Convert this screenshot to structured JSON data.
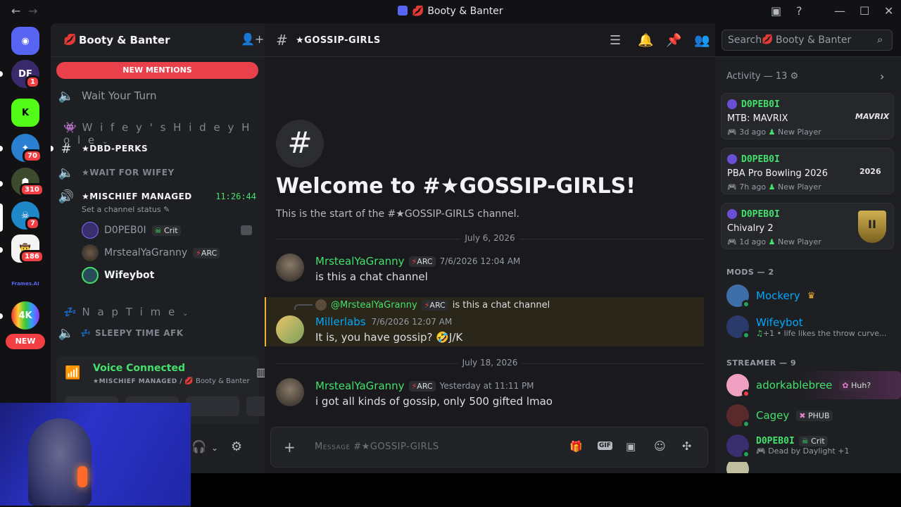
{
  "titlebar": {
    "back": "←",
    "forward": "→",
    "title": "Booty & Banter",
    "minimize": "—",
    "maximize": "☐",
    "close": "✕"
  },
  "rail": {
    "badges": [
      "1",
      "70",
      "310",
      "7",
      "186"
    ],
    "new_label": "NEW"
  },
  "sidebar": {
    "server_name": "Booty & Banter",
    "new_mentions": "NEW MENTIONS",
    "wait_channel": "Wait Your Turn",
    "category1": "W i f e y ' s  H i d e y  H o l e",
    "channels": [
      "★DBD-PERKS",
      "★WAIT FOR WIFEY",
      "★MISCHIEF MANAGED"
    ],
    "voice_timer": "11:26:44",
    "channel_status": "Set a channel status",
    "voice_users": [
      {
        "name": "D0PEB0I",
        "tag": "Crit"
      },
      {
        "name": "MrstealYaGranny",
        "tag": "ARC"
      },
      {
        "name": "Wifeybot",
        "tag": ""
      }
    ],
    "category2": "N a p  T i m e",
    "afk_channel": "SLEEPY TIME AFK",
    "voice_connected": "Voice Connected",
    "voice_location_channel": "★MISCHIEF MANAGED /",
    "voice_location_server": "Booty & Banter"
  },
  "header": {
    "channel": "★GOSSIP-GIRLS",
    "search_placeholder": "Search",
    "search_server": "Booty & Banter"
  },
  "main": {
    "welcome_title": "Welcome to #★GOSSIP-GIRLS!",
    "welcome_sub": "This is the start of the #★GOSSIP-GIRLS channel.",
    "date1": "July 6, 2026",
    "date2": "July 18, 2026",
    "messages": [
      {
        "author": "MrstealYaGranny",
        "tag": "ARC",
        "time": "7/6/2026 12:04 AM",
        "text": "is this a chat channel"
      },
      {
        "reply_to": "@MrstealYaGranny",
        "reply_tag": "ARC",
        "reply_text": "is this a chat channel",
        "author": "Millerlabs",
        "time": "7/6/2026 12:07 AM",
        "text": "It is, you have gossip? 🤣J/K"
      },
      {
        "author": "MrstealYaGranny",
        "tag": "ARC",
        "time": "Yesterday at 11:11 PM",
        "text": "i got all kinds of gossip, only 500 gifted lmao"
      }
    ],
    "composer_placeholder": "Message #★GOSSIP-GIRLS"
  },
  "members": {
    "activity_label": "Activity — 13",
    "activities": [
      {
        "user": "D0PEB0I",
        "game": "MTB: MAVRIX",
        "ago": "3d ago",
        "status": "New Player",
        "logo": "MAVRIX"
      },
      {
        "user": "D0PEB0I",
        "game": "PBA Pro Bowling 2026",
        "ago": "7h ago",
        "status": "New Player",
        "logo": "2026"
      },
      {
        "user": "D0PEB0I",
        "game": "Chivalry 2",
        "ago": "1d ago",
        "status": "New Player",
        "logo": "II"
      }
    ],
    "mods_label": "MODS — 2",
    "mods": [
      {
        "name": "Mockery",
        "sub": ""
      },
      {
        "name": "Wifeybot",
        "sub": "+1 • life likes the throw curve..."
      }
    ],
    "streamer_label": "STREAMER — 9",
    "streamers": [
      {
        "name": "adorkablebree",
        "tag": "Huh?",
        "sub": ""
      },
      {
        "name": "Cagey",
        "tag": "PHUB",
        "sub": ""
      },
      {
        "name": "D0PEB0I",
        "tag": "Crit",
        "sub": "Dead by Daylight +1"
      }
    ]
  },
  "colors": {
    "accent_green": "#43e06b",
    "mention_red": "#f23f43",
    "link_blue": "#00a8fc"
  }
}
